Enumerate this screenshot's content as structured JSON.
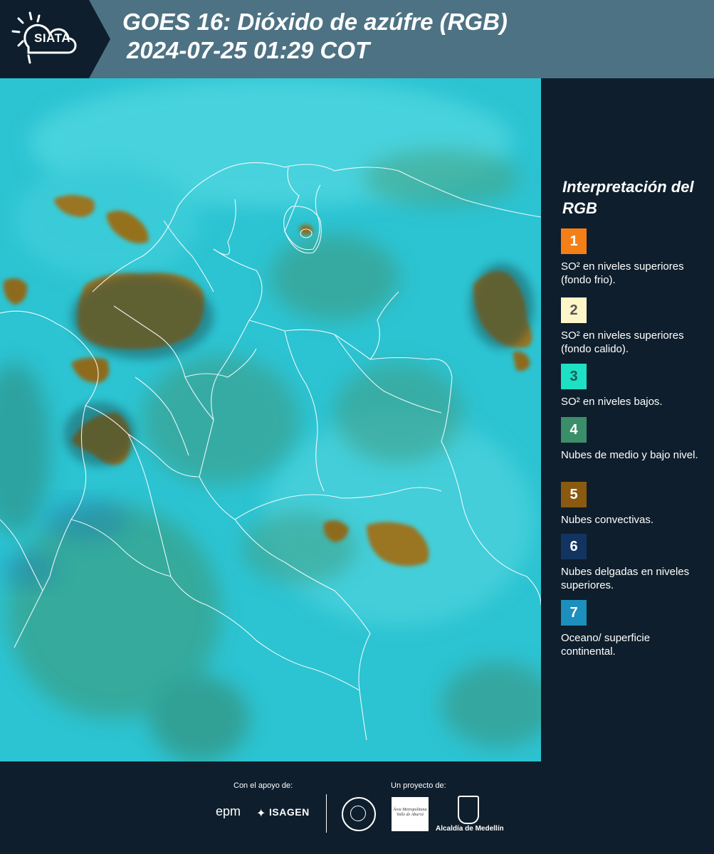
{
  "header": {
    "logo": "SIATA",
    "title_line1": "GOES 16: Dióxido de azúfre (RGB)",
    "title_line2": "2024-07-25 01:29 COT"
  },
  "legend": {
    "title": "Interpretación del RGB",
    "items": [
      {
        "number": "1",
        "color": "#f57f17",
        "text_color": "#ffffff",
        "label": "SO² en niveles superiores (fondo frio)."
      },
      {
        "number": "2",
        "color": "#fdf6c8",
        "text_color": "#555555",
        "label": "SO² en niveles superiores (fondo calido)."
      },
      {
        "number": "3",
        "color": "#1de0c4",
        "text_color": "#1a5a55",
        "label": "SO² en niveles bajos."
      },
      {
        "number": "4",
        "color": "#3a8f6a",
        "text_color": "#ffffff",
        "label": "Nubes de medio y bajo nivel."
      },
      {
        "number": "5",
        "color": "#8a5a10",
        "text_color": "#ffffff",
        "label": "Nubes convectivas."
      },
      {
        "number": "6",
        "color": "#123460",
        "text_color": "#ffffff",
        "label": "Nubes delgadas en niveles superiores."
      },
      {
        "number": "7",
        "color": "#1c8fbd",
        "text_color": "#ffffff",
        "label": "Oceano/ superficie continental."
      }
    ]
  },
  "footer": {
    "support_label": "Con el apoyo de:",
    "project_label": "Un proyecto de:",
    "sponsor1": "epm",
    "sponsor2": "ISAGEN",
    "partner1": "Área Metropolitana Valle de Aburrá",
    "partner2": "Alcaldía de Medellín"
  },
  "colors": {
    "header_bg": "#4d7283",
    "panel_bg": "#0e1e2c",
    "map_base": "#2fbfcf"
  }
}
